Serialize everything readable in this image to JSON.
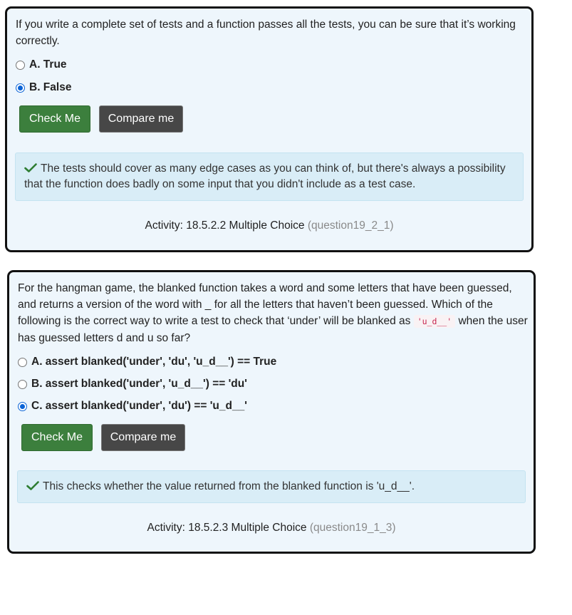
{
  "questions": [
    {
      "text": "If you write a complete set of tests and a function passes all the tests, you can be sure that it’s working correctly.",
      "options": [
        {
          "label": "A. True",
          "selected": false
        },
        {
          "label": "B. False",
          "selected": true
        }
      ],
      "check_label": "Check Me",
      "compare_label": "Compare me",
      "feedback": "The tests should cover as many edge cases as you can think of, but there's always a possibility that the function does badly on some input that you didn't include as a test case.",
      "activity_label": "Activity: 18.5.2.2 Multiple Choice",
      "activity_id": "(question19_2_1)"
    },
    {
      "text_before_code": "For the hangman game, the blanked function takes a word and some letters that have been guessed, and returns a version of the word with _ for all the letters that haven’t been guessed. Which of the following is the correct way to write a test to check that ‘under’ will be blanked as ",
      "code": "'u_d__'",
      "text_after_code": " when the user has guessed letters d and u so far?",
      "options": [
        {
          "label": "A. assert blanked('under', 'du', 'u_d__') == True",
          "selected": false
        },
        {
          "label": "B. assert blanked('under', 'u_d__') == 'du'",
          "selected": false
        },
        {
          "label": "C. assert blanked('under', 'du') == 'u_d__'",
          "selected": true
        }
      ],
      "check_label": "Check Me",
      "compare_label": "Compare me",
      "feedback": "This checks whether the value returned from the blanked function is 'u_d__'.",
      "activity_label": "Activity: 18.5.2.3 Multiple Choice",
      "activity_id": "(question19_1_3)"
    }
  ],
  "colors": {
    "card_bg": "#eef6fc",
    "check_button": "#3c7f3d",
    "compare_button": "#474747",
    "feedback_bg": "#d9edf7",
    "checkmark": "#2e7d32",
    "radio_selected": "#0a63d6"
  },
  "icons": {
    "feedback_icon": "checkmark-icon"
  }
}
